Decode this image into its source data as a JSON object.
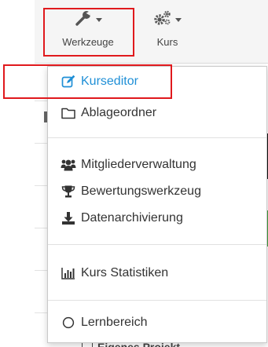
{
  "toolbar": {
    "werkzeuge": {
      "label": "Werkzeuge",
      "icon": "wrench-icon"
    },
    "kurs": {
      "label": "Kurs",
      "icon": "gears-icon"
    }
  },
  "menu": {
    "kurseditor": {
      "label": "Kurseditor",
      "icon": "edit-icon",
      "active": true
    },
    "ablageordner": {
      "label": "Ablageordner",
      "icon": "folder-icon"
    },
    "mitgliederverwaltung": {
      "label": "Mitgliederverwaltung",
      "icon": "users-icon"
    },
    "bewertungswerkzeug": {
      "label": "Bewertungswerkzeug",
      "icon": "trophy-icon"
    },
    "datenarchivierung": {
      "label": "Datenarchivierung",
      "icon": "download-icon"
    },
    "kurs_statistiken": {
      "label": "Kurs Statistiken",
      "icon": "bar-chart-icon"
    },
    "lernbereich": {
      "label": "Lernbereich",
      "icon": "circle-icon"
    }
  },
  "background": {
    "bottom_text": "Eigenes Projekt"
  },
  "colors": {
    "active": "#1f8fd6",
    "highlight": "#e0191d",
    "text": "#333333"
  }
}
